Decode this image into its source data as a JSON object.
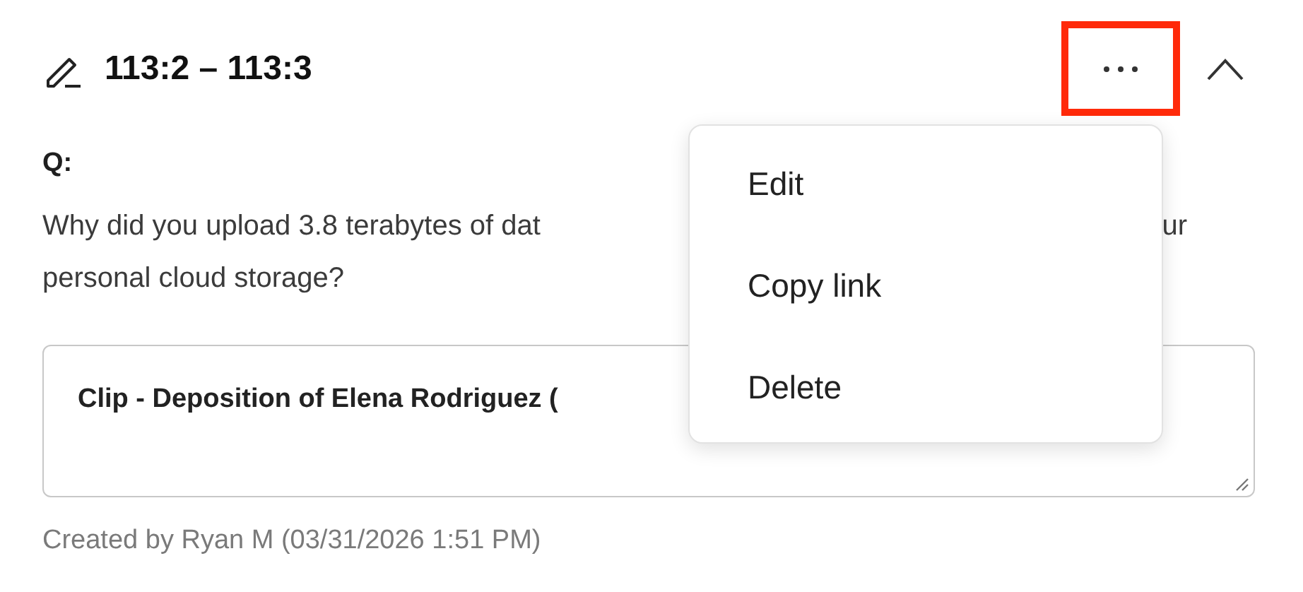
{
  "header": {
    "title": "113:2 – 113:3",
    "expanded": true
  },
  "more_menu": {
    "highlighted": true,
    "open": true,
    "items": [
      {
        "label": "Edit"
      },
      {
        "label": "Copy link"
      },
      {
        "label": "Delete"
      }
    ]
  },
  "question": {
    "label": "Q:",
    "line_1_start": "Why did you upload 3.8 terabytes of dat",
    "line_1_end": "ur",
    "line_2": "personal cloud storage?"
  },
  "clip_field": {
    "value": "Clip - Deposition of Elena Rodriguez ("
  },
  "footer": "Created by Ryan M (03/31/2026 1:51 PM)"
}
